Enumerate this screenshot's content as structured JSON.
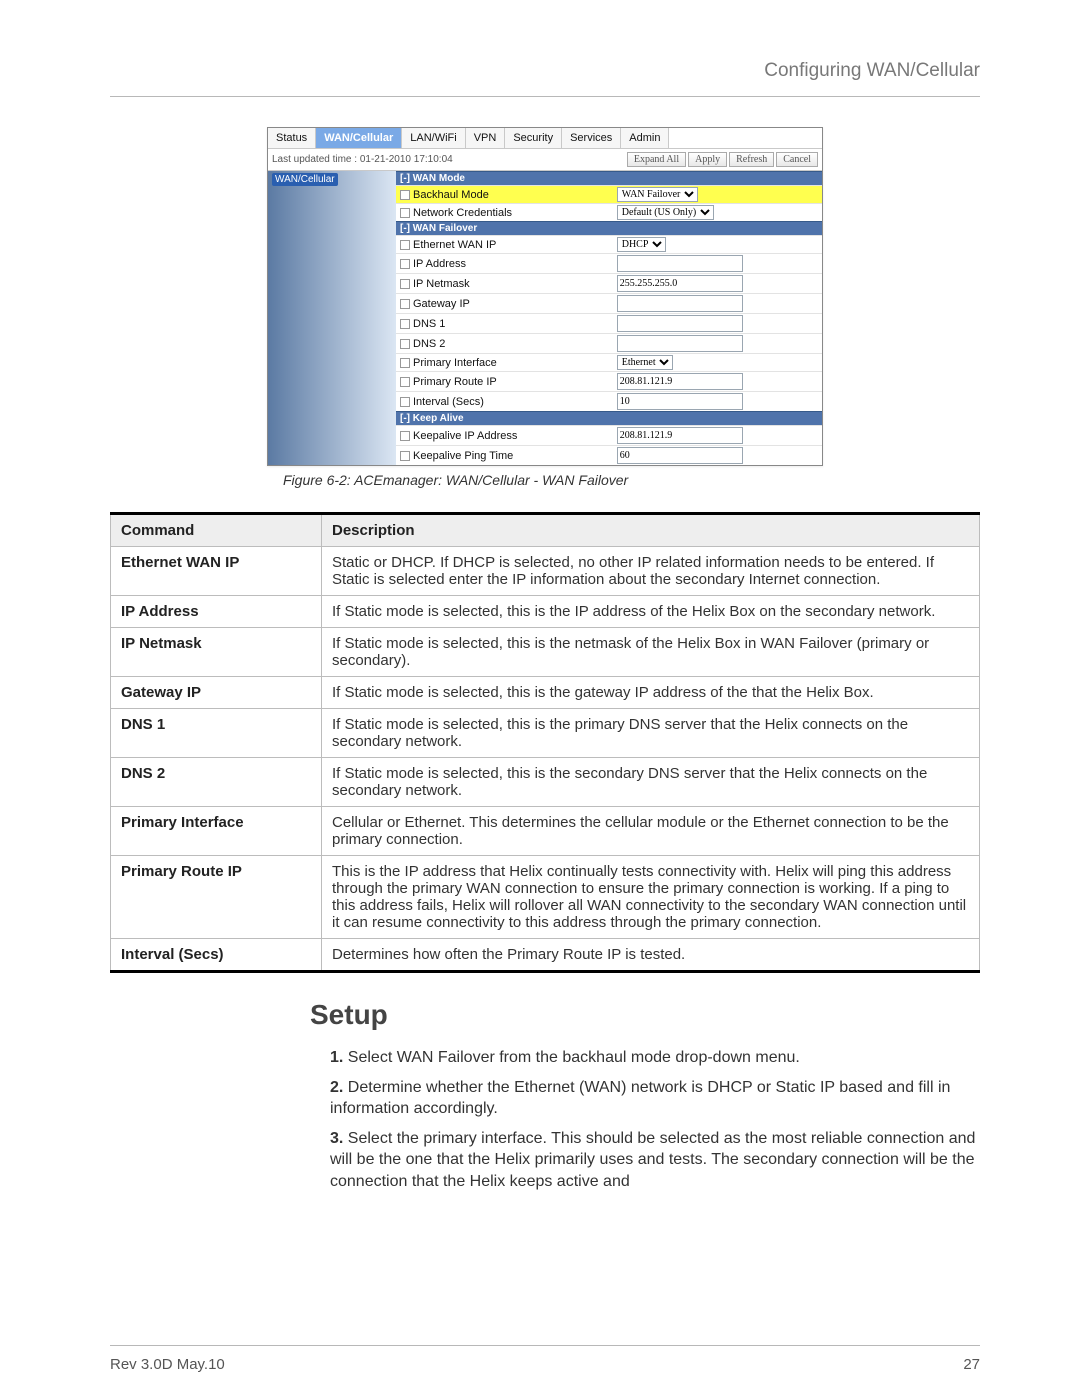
{
  "header": {
    "title": "Configuring WAN/Cellular"
  },
  "screenshot": {
    "tabs": [
      "Status",
      "WAN/Cellular",
      "LAN/WiFi",
      "VPN",
      "Security",
      "Services",
      "Admin"
    ],
    "active_tab_index": 1,
    "last_updated": "Last updated time : 01-21-2010 17:10:04",
    "buttons": {
      "expand": "Expand All",
      "apply": "Apply",
      "refresh": "Refresh",
      "cancel": "Cancel"
    },
    "side_label": "WAN/Cellular",
    "sections": {
      "wan_mode": {
        "title": "[-] WAN Mode",
        "rows": [
          {
            "label": "Backhaul Mode",
            "type": "select",
            "value": "WAN Failover",
            "highlight": true
          },
          {
            "label": "Network Credentials",
            "type": "select",
            "value": "Default (US Only)"
          }
        ]
      },
      "wan_failover": {
        "title": "[-] WAN Failover",
        "rows": [
          {
            "label": "Ethernet WAN IP",
            "type": "select",
            "value": "DHCP"
          },
          {
            "label": "IP Address",
            "type": "text",
            "value": ""
          },
          {
            "label": "IP Netmask",
            "type": "text",
            "value": "255.255.255.0"
          },
          {
            "label": "Gateway IP",
            "type": "text",
            "value": ""
          },
          {
            "label": "DNS 1",
            "type": "text",
            "value": ""
          },
          {
            "label": "DNS 2",
            "type": "text",
            "value": ""
          },
          {
            "label": "Primary Interface",
            "type": "select",
            "value": "Ethernet"
          },
          {
            "label": "Primary Route IP",
            "type": "text",
            "value": "208.81.121.9"
          },
          {
            "label": "Interval (Secs)",
            "type": "text",
            "value": "10"
          }
        ]
      },
      "keep_alive": {
        "title": "[-] Keep Alive",
        "rows": [
          {
            "label": "Keepalive IP Address",
            "type": "text",
            "value": "208.81.121.9"
          },
          {
            "label": "Keepalive Ping Time",
            "type": "text",
            "value": "60"
          }
        ]
      }
    }
  },
  "figure_caption": "Figure 6-2: ACEmanager: WAN/Cellular - WAN Failover",
  "table": {
    "head": {
      "command": "Command",
      "description": "Description"
    },
    "rows": [
      {
        "command": "Ethernet WAN IP",
        "description": "Static or DHCP. If DHCP is selected, no other IP related information needs to be entered. If Static is selected enter the IP information about the secondary Internet connection."
      },
      {
        "command": "IP Address",
        "description": "If Static mode is selected, this is the IP address of the Helix Box on the secondary network."
      },
      {
        "command": "IP Netmask",
        "description": "If Static mode is selected, this is the netmask of the Helix Box in WAN Failover (primary or secondary)."
      },
      {
        "command": "Gateway IP",
        "description": "If Static mode is selected, this is the gateway IP address of  the that the Helix Box."
      },
      {
        "command": "DNS 1",
        "description": "If Static mode is selected, this is the primary DNS server that the Helix connects on the secondary network."
      },
      {
        "command": "DNS 2",
        "description": "If Static mode is selected, this is the secondary DNS server that the Helix connects on the secondary network."
      },
      {
        "command": "Primary Interface",
        "description": "Cellular or Ethernet. This determines the cellular module or the Ethernet connection to be the primary connection."
      },
      {
        "command": "Primary Route IP",
        "description": "This is the IP address that Helix continually tests connectivity with. Helix will ping this address through the primary WAN connection to ensure the primary connection is working. If a ping to this address fails, Helix will rollover all WAN connectivity to the secondary WAN connection until it can resume connectivity to this address through the primary connection."
      },
      {
        "command": "Interval (Secs)",
        "description": "Determines how often the Primary Route IP is tested."
      }
    ]
  },
  "setup": {
    "title": "Setup",
    "steps": [
      "Select WAN Failover from the backhaul mode drop-down menu.",
      "Determine whether the Ethernet (WAN) network is DHCP or Static IP based and fill in information accordingly.",
      "Select the primary interface. This should be selected as the most reliable connection and will be the one that the Helix primarily uses and tests. The secondary connection will be the connection that the Helix keeps active and"
    ]
  },
  "footer": {
    "left": "Rev 3.0D  May.10",
    "right": "27"
  }
}
